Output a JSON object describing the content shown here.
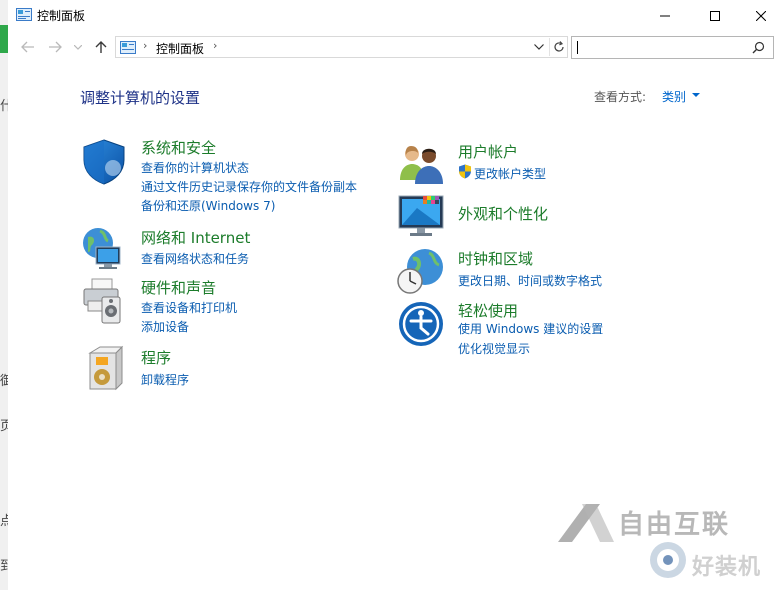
{
  "background_window": {
    "glyphs": [
      "什",
      "御",
      "页",
      "点",
      "到"
    ]
  },
  "window": {
    "title": "控制面板",
    "buttons": {
      "minimize": "─",
      "maximize": "☐",
      "close": "✕"
    }
  },
  "address": {
    "breadcrumb": "控制面板",
    "separator": "›",
    "search_placeholder": ""
  },
  "main": {
    "heading": "调整计算机的设置",
    "view_by_label": "查看方式:",
    "view_by_value": "类别",
    "categories": [
      {
        "title": "系统和安全",
        "icon": "shield-icon",
        "links": [
          "查看你的计算机状态",
          "通过文件历史记录保存你的文件备份副本",
          "备份和还原(Windows 7)"
        ]
      },
      {
        "title": "网络和 Internet",
        "icon": "network-globe-icon",
        "links": [
          "查看网络状态和任务"
        ]
      },
      {
        "title": "硬件和声音",
        "icon": "printer-speaker-icon",
        "links": [
          "查看设备和打印机",
          "添加设备"
        ]
      },
      {
        "title": "程序",
        "icon": "programs-icon",
        "links": [
          "卸载程序"
        ]
      },
      {
        "title": "用户帐户",
        "icon": "users-icon",
        "links": [
          "更改帐户类型"
        ]
      },
      {
        "title": "外观和个性化",
        "icon": "monitor-palette-icon",
        "links": []
      },
      {
        "title": "时钟和区域",
        "icon": "clock-globe-icon",
        "links": [
          "更改日期、时间或数字格式"
        ]
      },
      {
        "title": "轻松使用",
        "icon": "ease-of-access-icon",
        "links": [
          "使用 Windows 建议的设置",
          "优化视觉显示"
        ]
      }
    ]
  },
  "watermark": {
    "line1": "自由互联",
    "line2": "好装机"
  },
  "colors": {
    "heading": "#1e3287",
    "category_title": "#1c7c2b",
    "link": "#0b5db0",
    "view_by_value": "#0066cc"
  }
}
